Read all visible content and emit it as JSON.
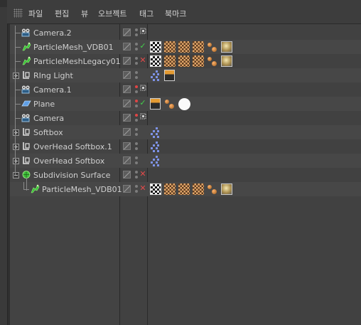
{
  "menu": [
    {
      "id": "file",
      "label": "파일"
    },
    {
      "id": "edit",
      "label": "편집"
    },
    {
      "id": "view",
      "label": "뷰"
    },
    {
      "id": "object",
      "label": "오브젝트"
    },
    {
      "id": "tag",
      "label": "태그"
    },
    {
      "id": "bookmark",
      "label": "북마크"
    }
  ],
  "objects": [
    {
      "name": "Camera.2",
      "type": "camera-icon",
      "depth": 0,
      "expander": "",
      "dot_top": "grey",
      "dot_bottom": "grey",
      "status": "vis",
      "tags": []
    },
    {
      "name": "ParticleMesh_VDB01",
      "type": "particle-mesh-icon",
      "depth": 0,
      "expander": "",
      "dot_top": "grey",
      "dot_bottom": "grey",
      "status": "check",
      "tags": [
        "checker",
        "checker-o",
        "checker-o",
        "checker-o",
        "spheres",
        "texsphere"
      ]
    },
    {
      "name": "ParticleMeshLegacy01",
      "type": "particle-mesh-icon",
      "depth": 0,
      "expander": "",
      "dot_top": "grey",
      "dot_bottom": "grey",
      "status": "cross",
      "tags": [
        "checker",
        "checker-o",
        "checker-o",
        "checker-o",
        "spheres",
        "texsphere"
      ]
    },
    {
      "name": "RIng Light",
      "type": "light-icon",
      "depth": 0,
      "expander": "plus",
      "dot_top": "grey",
      "dot_bottom": "grey",
      "status": "",
      "tags": [
        "dotgrid",
        "clapper"
      ]
    },
    {
      "name": "Camera.1",
      "type": "camera-icon",
      "depth": 0,
      "expander": "",
      "dot_top": "red",
      "dot_bottom": "grey",
      "status": "vis",
      "tags": []
    },
    {
      "name": "Plane",
      "type": "plane-icon",
      "depth": 0,
      "expander": "",
      "dot_top": "red",
      "dot_bottom": "grey",
      "status": "check",
      "tags": [
        "clapper",
        "spheres",
        "whiteball"
      ]
    },
    {
      "name": "Camera",
      "type": "camera-icon",
      "depth": 0,
      "expander": "",
      "dot_top": "red",
      "dot_bottom": "grey",
      "status": "vis",
      "tags": []
    },
    {
      "name": "Softbox",
      "type": "light-icon",
      "depth": 0,
      "expander": "plus",
      "dot_top": "grey",
      "dot_bottom": "grey",
      "status": "",
      "tags": [
        "dotgrid"
      ]
    },
    {
      "name": "OverHead Softbox.1",
      "type": "light-icon",
      "depth": 0,
      "expander": "plus",
      "dot_top": "grey",
      "dot_bottom": "grey",
      "status": "",
      "tags": [
        "dotgrid"
      ]
    },
    {
      "name": "OverHead Softbox",
      "type": "light-icon",
      "depth": 0,
      "expander": "plus",
      "dot_top": "grey",
      "dot_bottom": "grey",
      "status": "",
      "tags": [
        "dotgrid"
      ]
    },
    {
      "name": "Subdivision Surface",
      "type": "subdivision-icon",
      "depth": 0,
      "expander": "minus",
      "dot_top": "grey",
      "dot_bottom": "grey",
      "status": "cross",
      "tags": []
    },
    {
      "name": "ParticleMesh_VDB01",
      "type": "particle-mesh-icon",
      "depth": 1,
      "expander": "",
      "dot_top": "grey",
      "dot_bottom": "grey",
      "status": "cross",
      "tags": [
        "checker",
        "checker-o",
        "checker-o",
        "checker-o",
        "spheres",
        "texsphere"
      ]
    }
  ]
}
